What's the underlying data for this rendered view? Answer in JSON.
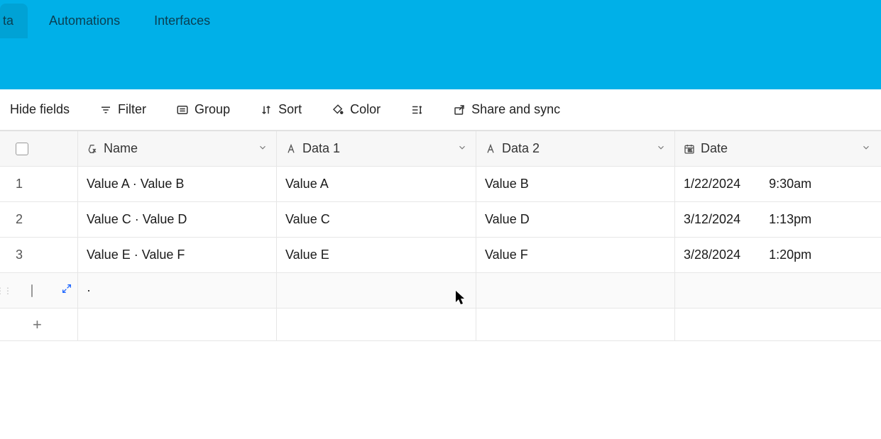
{
  "tabs": {
    "data": "ta",
    "automations": "Automations",
    "interfaces": "Interfaces"
  },
  "toolbar": {
    "hide_fields": "Hide fields",
    "filter": "Filter",
    "group": "Group",
    "sort": "Sort",
    "color": "Color",
    "share_sync": "Share and sync"
  },
  "columns": {
    "name": "Name",
    "data1": "Data 1",
    "data2": "Data 2",
    "date": "Date"
  },
  "rows": [
    {
      "num": "1",
      "name": "Value A · Value B",
      "data1": "Value A",
      "data2": "Value B",
      "date": "1/22/2024",
      "time": "9:30am"
    },
    {
      "num": "2",
      "name": "Value C · Value D",
      "data1": "Value C",
      "data2": "Value D",
      "date": "3/12/2024",
      "time": "1:13pm"
    },
    {
      "num": "3",
      "name": "Value E · Value F",
      "data1": "Value E",
      "data2": "Value F",
      "date": "3/28/2024",
      "time": "1:20pm"
    }
  ],
  "empty_row_dot": "·"
}
